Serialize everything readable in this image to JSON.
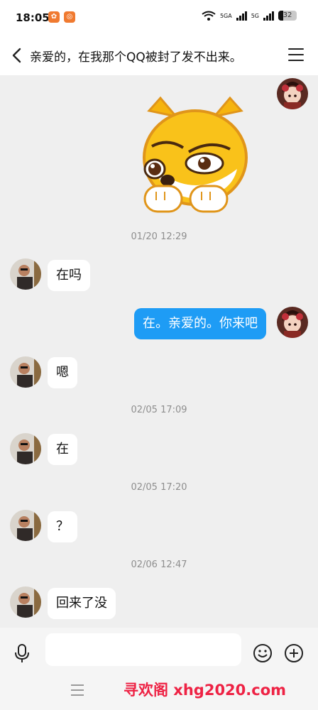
{
  "status_bar": {
    "time": "18:05",
    "network_1": "5GA",
    "network_2": "5G",
    "battery": "32"
  },
  "header": {
    "title": "亲爱的，在我那个QQ被封了发不出来。"
  },
  "messages": [
    {
      "sender": "me",
      "type": "sticker",
      "description": "yellow cartoon dog sticker"
    },
    {
      "type": "timestamp",
      "text": "01/20 12:29"
    },
    {
      "sender": "other",
      "text": "在吗"
    },
    {
      "sender": "me",
      "text": "在。亲爱的。你来吧"
    },
    {
      "sender": "other",
      "text": "嗯"
    },
    {
      "type": "timestamp",
      "text": "02/05 17:09"
    },
    {
      "sender": "other",
      "text": "在"
    },
    {
      "type": "timestamp",
      "text": "02/05 17:20"
    },
    {
      "sender": "other",
      "text": "？"
    },
    {
      "type": "timestamp",
      "text": "02/06 12:47"
    },
    {
      "sender": "other",
      "text": "回来了没"
    }
  ],
  "input_bar": {
    "placeholder": ""
  },
  "watermark": "寻欢阁 xhg2020.com",
  "colors": {
    "my_bubble": "#1e9cf5",
    "other_bubble": "#ffffff",
    "background": "#efefef",
    "watermark": "#ee2244"
  }
}
